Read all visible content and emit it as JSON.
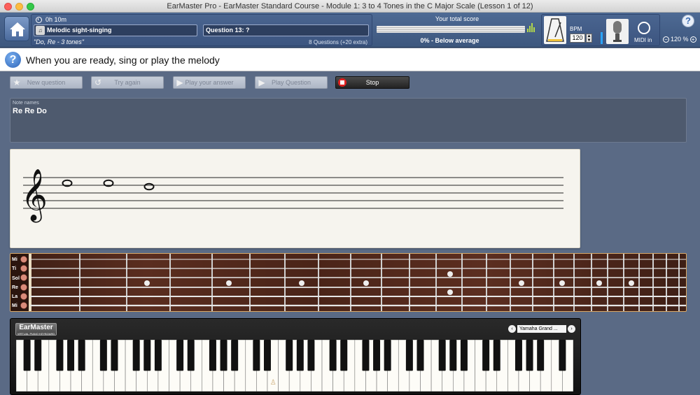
{
  "window": {
    "title": "EarMaster Pro - EarMaster Standard Course - Module 1: 3 to 4 Tones in the C Major Scale (Lesson 1 of 12)"
  },
  "exercise": {
    "time": "0h 10m",
    "name": "Melodic sight-singing",
    "question": "Question 13: ?",
    "subtitle": "\"Do, Re - 3 tones\"",
    "count": "8 Questions (+20 extra)"
  },
  "score": {
    "title": "Your total score",
    "result": "0% - Below average",
    "progress": 0
  },
  "tools": {
    "bpm_label": "BPM",
    "bpm_value": "120",
    "midi_label": "MIDI in"
  },
  "zoom": {
    "value": "120 %"
  },
  "instruction": {
    "text": "When you are ready, sing or play the melody"
  },
  "buttons": {
    "new_question": "New question",
    "try_again": "Try again",
    "play_answer": "Play your answer",
    "play_question": "Play Question",
    "stop": "Stop"
  },
  "note_names": {
    "label": "Note names",
    "value": "Re Re Do"
  },
  "guitar": {
    "strings": [
      "Mi",
      "Ti",
      "Sol",
      "Re",
      "La",
      "Mi"
    ]
  },
  "piano": {
    "logo": "EarMaster",
    "logo_sub": "VIRTUAL PIANO KEYBOARD",
    "instrument": "Yamaha Grand ..."
  },
  "colors": {
    "accent": "#3d577e",
    "stop": "#e02020",
    "midi_vu": "#2aa4ff"
  }
}
